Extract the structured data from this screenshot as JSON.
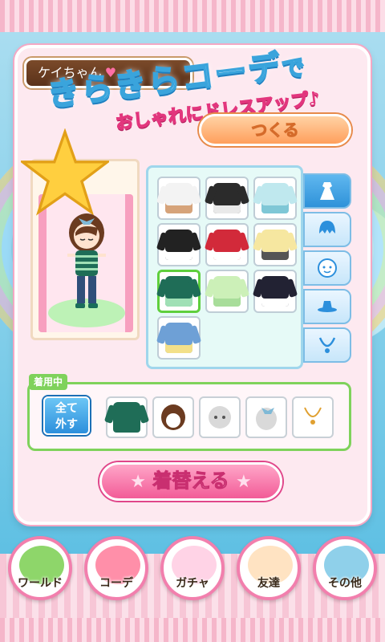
{
  "header": {
    "player_name": "ケイちゃん",
    "heart_icon": "heart-icon"
  },
  "banner": {
    "title_main": "きらきらコーデ",
    "title_tail": "で",
    "subtitle": "おしゃれにドレスアップ♪"
  },
  "create_button": {
    "label": "つくる"
  },
  "wardrobe": {
    "items": [
      {
        "name": "white-shirt-outfit",
        "color": "#f3f3f3",
        "accent": "#d6a37a"
      },
      {
        "name": "black-top-outfit",
        "color": "#2b2b2b",
        "accent": "#e9e9e9"
      },
      {
        "name": "teal-print-outfit",
        "color": "#bfe8ee",
        "accent": "#7fc7d6"
      },
      {
        "name": "black-jacket-outfit",
        "color": "#222",
        "accent": "#fff"
      },
      {
        "name": "red-jacket-outfit",
        "color": "#d22a3a",
        "accent": "#fff"
      },
      {
        "name": "cream-shirt-outfit",
        "color": "#f6e7a0",
        "accent": "#555"
      },
      {
        "name": "striped-green-outfit",
        "color": "#1f6d57",
        "accent": "#9fe0b5"
      },
      {
        "name": "light-green-outfit",
        "color": "#ccf0b8",
        "accent": "#a8dd9a"
      },
      {
        "name": "navy-dress-outfit",
        "color": "#223",
        "accent": "#fff"
      },
      {
        "name": "denim-jacket-outfit",
        "color": "#6ea0d6",
        "accent": "#f3e08a"
      }
    ],
    "selected_index": 6
  },
  "category_tabs": [
    {
      "name": "tab-clothes",
      "icon": "dress-icon",
      "active": true
    },
    {
      "name": "tab-hair",
      "icon": "hair-icon",
      "active": false
    },
    {
      "name": "tab-face",
      "icon": "face-icon",
      "active": false
    },
    {
      "name": "tab-hat",
      "icon": "hat-icon",
      "active": false
    },
    {
      "name": "tab-accessory",
      "icon": "necklace-icon",
      "active": false
    }
  ],
  "wearing": {
    "label": "着用中",
    "remove_all_line1": "全て",
    "remove_all_line2": "外す",
    "items": [
      "worn-outfit",
      "worn-hair",
      "worn-face",
      "worn-hair-accessory",
      "worn-necklace"
    ]
  },
  "change_button": {
    "label": "着替える"
  },
  "bottom_nav": [
    {
      "name": "nav-world",
      "label": "ワールド",
      "color": "#8ed66a"
    },
    {
      "name": "nav-coordinate",
      "label": "コーデ",
      "color": "#ff8fa9"
    },
    {
      "name": "nav-gacha",
      "label": "ガチャ",
      "color": "#ffd3e6"
    },
    {
      "name": "nav-friends",
      "label": "友達",
      "color": "#ffe3c2"
    },
    {
      "name": "nav-other",
      "label": "その他",
      "color": "#8fd0ea"
    }
  ]
}
